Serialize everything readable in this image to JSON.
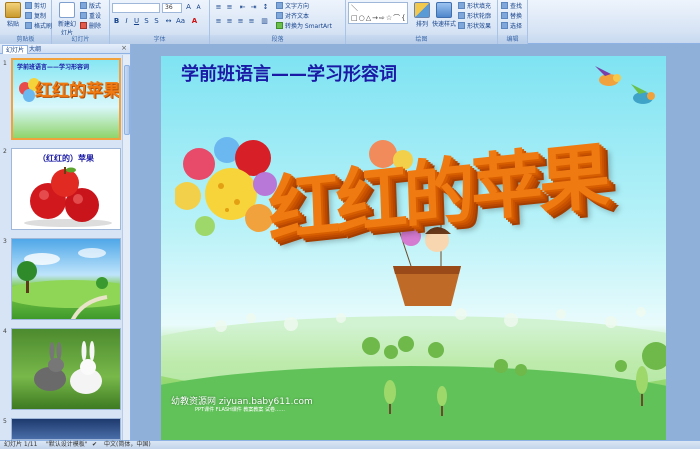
{
  "ribbon": {
    "groups": {
      "clipboard": "剪贴板",
      "slides": "幻灯片",
      "font": "字体",
      "paragraph": "段落",
      "drawing": "绘图",
      "editing": "编辑"
    },
    "paste_label": "粘贴",
    "cut_label": "剪切",
    "copy_label": "复制",
    "format_painter_label": "格式刷",
    "new_slide_label": "新建幻灯片",
    "layout_label": "版式",
    "reset_label": "重设",
    "delete_label": "删除",
    "font_name": "",
    "font_size": "36",
    "text_direction_label": "文字方向",
    "align_text_label": "对齐文本",
    "smartart_label": "转换为 SmartArt",
    "arrange_label": "排列",
    "quick_styles_label": "快速样式",
    "shape_fill_label": "形状填充",
    "shape_outline_label": "形状轮廓",
    "shape_effects_label": "形状效果",
    "find_label": "查找",
    "replace_label": "替换",
    "select_label": "选择"
  },
  "panel": {
    "tab_slides": "幻灯片",
    "tab_outline": "大纲",
    "close": "×",
    "thumbs": [
      {
        "num": "1",
        "title": "学前班语言——学习形容词",
        "subtitle": "红红的苹果"
      },
      {
        "num": "2",
        "title": "（红红的）苹果"
      },
      {
        "num": "3"
      },
      {
        "num": "4"
      },
      {
        "num": "5"
      }
    ]
  },
  "slide": {
    "title": "学前班语言——学习形容词",
    "big_text": "红红的苹果",
    "watermark": "幼教资源网 ziyuan.baby611.com",
    "watermark_small": "PPT课件  FLASH课件  教案教案  试卷……"
  },
  "status": {
    "slide_count": "幻灯片 1/11",
    "theme": "\"默认设计模板\"",
    "language": "中文(简体，中国)"
  },
  "colors": {
    "slide_title": "#1a1aa6",
    "big_text": "#f07a12",
    "ribbon_bg": "#d7e4f5"
  }
}
